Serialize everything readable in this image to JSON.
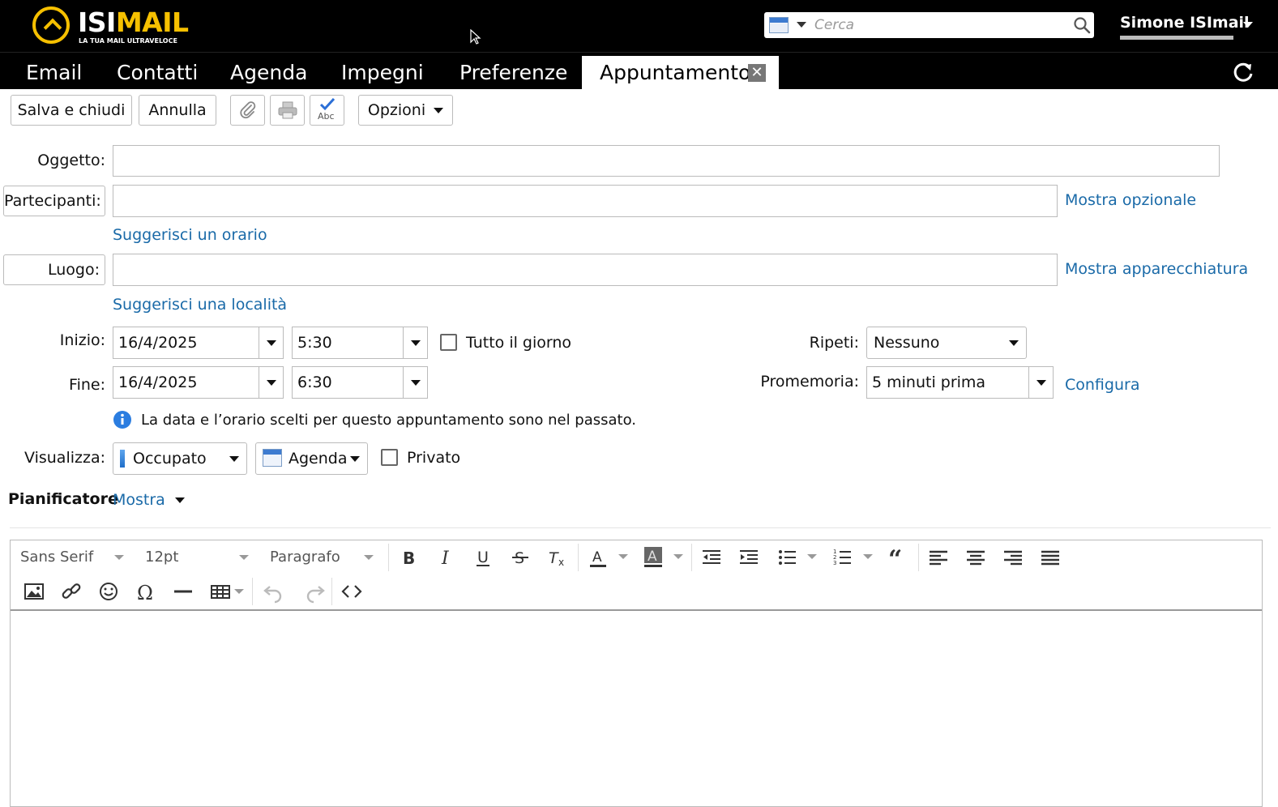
{
  "header": {
    "logo_text_1": "ISI",
    "logo_text_2": "MAIL",
    "logo_tagline": "LA TUA MAIL ULTRAVELOCE",
    "search_placeholder": "Cerca",
    "user_name": "Simone ISImail"
  },
  "tabs": [
    {
      "label": "Email"
    },
    {
      "label": "Contatti"
    },
    {
      "label": "Agenda"
    },
    {
      "label": "Impegni"
    },
    {
      "label": "Preferenze"
    },
    {
      "label": "Appuntamento",
      "active": true,
      "close": "✕"
    }
  ],
  "toolbar": {
    "save_close": "Salva e chiudi",
    "cancel": "Annulla",
    "options": "Opzioni"
  },
  "form": {
    "subject_label": "Oggetto:",
    "subject_value": "",
    "attendees_label": "Partecipanti:",
    "attendees_value": "",
    "show_optional": "Mostra opzionale",
    "suggest_time": "Suggerisci un orario",
    "location_label": "Luogo:",
    "location_value": "",
    "show_equipment": "Mostra apparecchiatura",
    "suggest_location": "Suggerisci una località",
    "start_label": "Inizio:",
    "start_date": "16/4/2025",
    "start_time": "5:30",
    "all_day_label": "Tutto il giorno",
    "repeat_label": "Ripeti:",
    "repeat_value": "Nessuno",
    "end_label": "Fine:",
    "end_date": "16/4/2025",
    "end_time": "6:30",
    "reminder_label": "Promemoria:",
    "reminder_value": "5 minuti prima",
    "configure": "Configura",
    "past_notice": "La data e l’orario scelti per questo appuntamento sono nel passato.",
    "display_label": "Visualizza:",
    "display_value": "Occupato",
    "calendar_value": "Agenda",
    "private_label": "Privato",
    "scheduler_label": "Pianificatore",
    "scheduler_show": "Mostra"
  },
  "editor": {
    "font_family": "Sans Serif",
    "font_size": "12pt",
    "block_format": "Paragrafo"
  },
  "colors": {
    "brand_yellow": "#f6c000",
    "link_blue": "#1a6aa8",
    "bar_black": "#000000"
  }
}
